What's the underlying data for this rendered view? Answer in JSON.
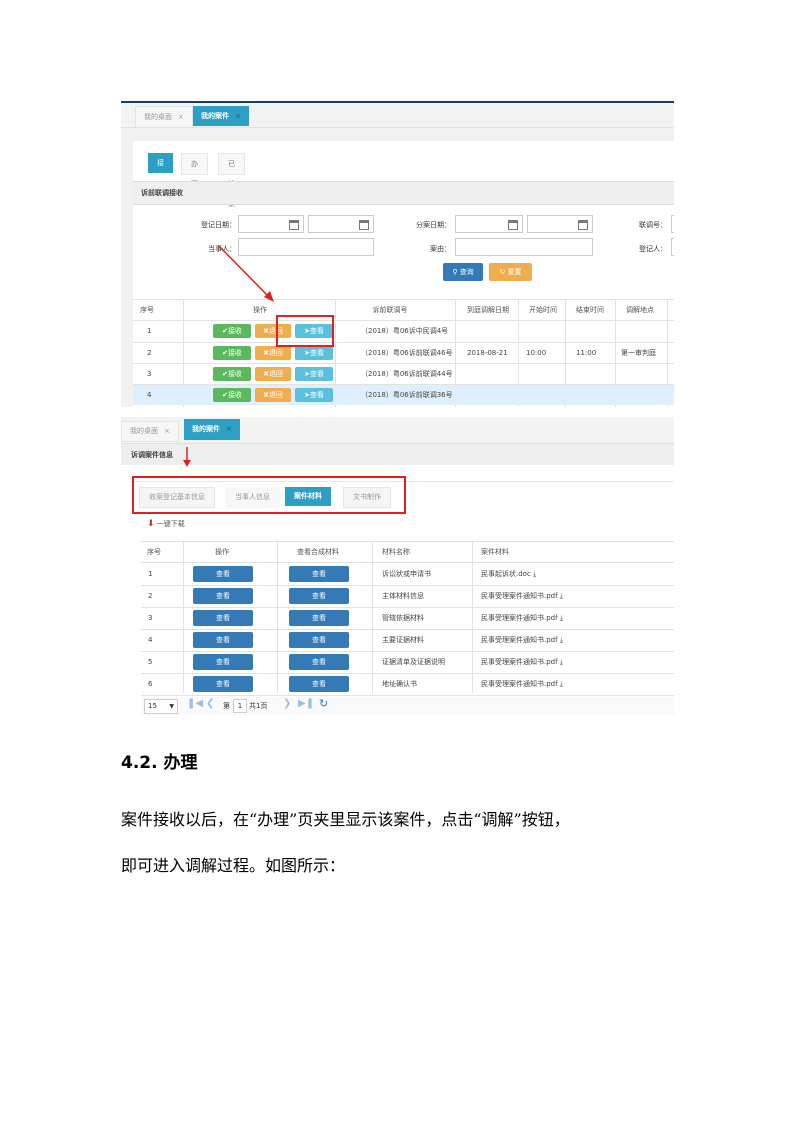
{
  "shot1": {
    "tabs": [
      "我的桌面",
      "我的案件"
    ],
    "tab_close": "×",
    "subtabs": [
      "接收",
      "办理",
      "已结案"
    ],
    "section_title": "诉前联调接收",
    "filters": {
      "reg_date_label": "登记日期：",
      "assign_date_label": "分案日期：",
      "mediation_no_label": "联调号：",
      "party_label": "当事人：",
      "cause_label": "案由：",
      "registrar_label": "登记人："
    },
    "search_button": "查询",
    "reset_button": "重置",
    "columns": [
      "序号",
      "操作",
      "诉前联调号",
      "到庭调解日期",
      "开始时间",
      "结束时间",
      "调解地点"
    ],
    "action_labels": {
      "receive": "接收",
      "return": "退回",
      "view": "查看"
    },
    "rows": [
      {
        "no": "1",
        "case_no": "（2018）粤06诉中民调4号",
        "date": "",
        "start": "",
        "end": "",
        "place": ""
      },
      {
        "no": "2",
        "case_no": "（2018）粤06诉前联调46号",
        "date": "2018-08-21",
        "start": "10:00",
        "end": "11:00",
        "place": "第一审判庭"
      },
      {
        "no": "3",
        "case_no": "（2018）粤06诉前联调44号",
        "date": "",
        "start": "",
        "end": "",
        "place": ""
      },
      {
        "no": "4",
        "case_no": "（2018）粤06诉前联调36号",
        "date": "",
        "start": "",
        "end": "",
        "place": ""
      }
    ]
  },
  "shot2": {
    "tabs": [
      "我的桌面",
      "我的案件"
    ],
    "tab_close": "×",
    "section_title": "诉调案件信息",
    "case_tabs": [
      "收案登记基本信息",
      "当事人信息",
      "案件材料",
      "文书制作"
    ],
    "download_all": "一键下载",
    "columns": [
      "序号",
      "操作",
      "查看合成材料",
      "材料名称",
      "案件材料"
    ],
    "view_label": "查看",
    "rows": [
      {
        "no": "1",
        "name": "诉讼状或申请书",
        "file": "民事起诉状.doc"
      },
      {
        "no": "2",
        "name": "主体材料信息",
        "file": "民事受理案件通知书.pdf"
      },
      {
        "no": "3",
        "name": "管辖依据材料",
        "file": "民事受理案件通知书.pdf"
      },
      {
        "no": "4",
        "name": "主要证据材料",
        "file": "民事受理案件通知书.pdf"
      },
      {
        "no": "5",
        "name": "证据清单及证据说明",
        "file": "民事受理案件通知书.pdf"
      },
      {
        "no": "6",
        "name": "地址确认书",
        "file": "民事受理案件通知书.pdf"
      }
    ],
    "pager": {
      "page_size": "15",
      "page_prefix": "第",
      "page_no": "1",
      "page_suffix": "共1页"
    }
  },
  "doc": {
    "heading": "4.2.  办理",
    "para1": "案件接收以后，在“办理”页夹里显示该案件，点击“调解”按钮，",
    "para2": "即可进入调解过程。如图所示："
  },
  "colors": {
    "accent": "#2b9fc4",
    "primary": "#337ab7",
    "warning": "#f0ad4e",
    "success": "#5cb85c",
    "info": "#5bc0de",
    "annotation": "#e02020"
  }
}
